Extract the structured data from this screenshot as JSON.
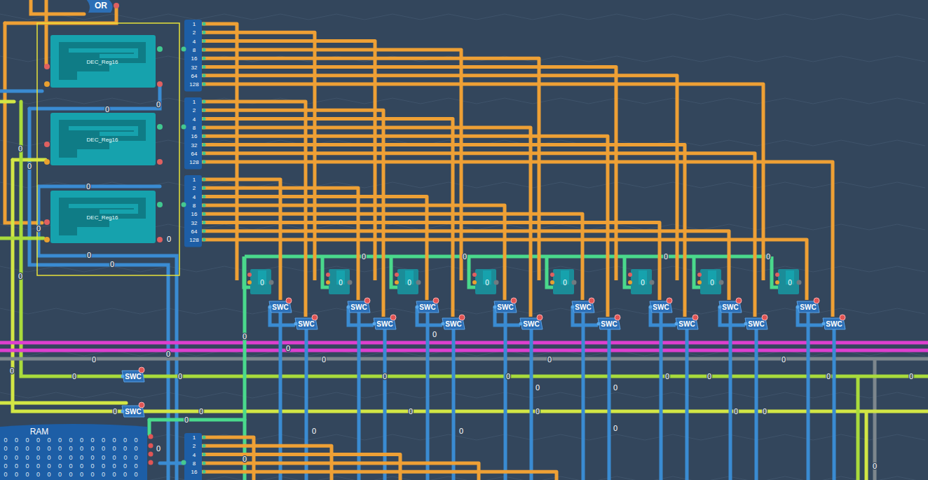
{
  "gate": {
    "label": "OR"
  },
  "registers": [
    {
      "label": "DEC_Reg16"
    },
    {
      "label": "DEC_Reg16"
    },
    {
      "label": "DEC_Reg16"
    }
  ],
  "splitters": [
    {
      "bits": [
        "1",
        "2",
        "4",
        "8",
        "16",
        "32",
        "64",
        "128"
      ]
    },
    {
      "bits": [
        "1",
        "2",
        "4",
        "8",
        "16",
        "32",
        "64",
        "128"
      ]
    },
    {
      "bits": [
        "1",
        "2",
        "4",
        "8",
        "16",
        "32",
        "64",
        "128"
      ]
    },
    {
      "bits": [
        "1",
        "2",
        "4",
        "8",
        "16"
      ]
    }
  ],
  "counters": [
    {
      "value": "0"
    },
    {
      "value": "0"
    },
    {
      "value": "0"
    },
    {
      "value": "0"
    },
    {
      "value": "0"
    },
    {
      "value": "0"
    },
    {
      "value": "0"
    },
    {
      "value": "0"
    }
  ],
  "switches": [
    {
      "label": "SWC"
    },
    {
      "label": "SWC"
    },
    {
      "label": "SWC"
    },
    {
      "label": "SWC"
    },
    {
      "label": "SWC"
    },
    {
      "label": "SWC"
    },
    {
      "label": "SWC"
    },
    {
      "label": "SWC"
    },
    {
      "label": "SWC"
    },
    {
      "label": "SWC"
    },
    {
      "label": "SWC"
    },
    {
      "label": "SWC"
    },
    {
      "label": "SWC"
    },
    {
      "label": "SWC"
    },
    {
      "label": "SWC"
    },
    {
      "label": "SWC"
    },
    {
      "label": "SWC"
    },
    {
      "label": "SWC"
    }
  ],
  "ram": {
    "label": "RAM",
    "cells": [
      [
        "0",
        "0",
        "0",
        "0",
        "0",
        "0",
        "0",
        "0",
        "0",
        "0",
        "0",
        "0",
        "0"
      ],
      [
        "0",
        "0",
        "0",
        "0",
        "0",
        "0",
        "0",
        "0",
        "0",
        "0",
        "0",
        "0",
        "0"
      ],
      [
        "0",
        "0",
        "0",
        "0",
        "0",
        "0",
        "0",
        "0",
        "0",
        "0",
        "0",
        "0",
        "0"
      ],
      [
        "0",
        "0",
        "0",
        "0",
        "0",
        "0",
        "0",
        "0",
        "0",
        "0",
        "0",
        "0",
        "0"
      ],
      [
        "0",
        "0",
        "0",
        "0",
        "0",
        "0",
        "0",
        "0",
        "0",
        "0",
        "0",
        "0",
        "0"
      ]
    ]
  },
  "wire_values": [
    "0",
    "0",
    "0",
    "0",
    "0",
    "0",
    "0",
    "0",
    "0",
    "0",
    "0",
    "0",
    "0",
    "0",
    "0",
    "0",
    "0",
    "0",
    "0",
    "0",
    "0",
    "0",
    "0",
    "0",
    "0",
    "0",
    "0",
    "0",
    "0",
    "0",
    "0",
    "0",
    "0",
    "0",
    "0",
    "0",
    "0",
    "0",
    "0",
    "0",
    "0",
    "0",
    "0",
    "0",
    "0",
    "0"
  ]
}
